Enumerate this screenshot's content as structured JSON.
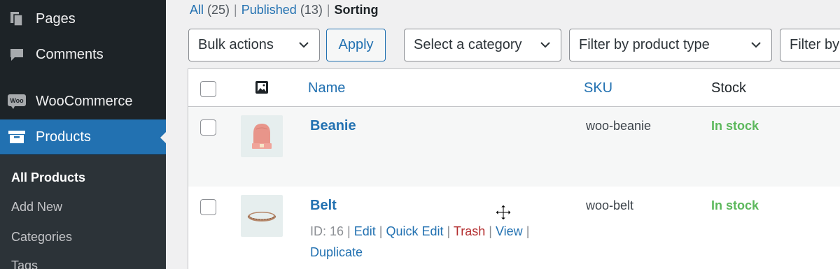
{
  "sidebar": {
    "menu": [
      {
        "label": "Pages",
        "icon": "pages-icon"
      },
      {
        "label": "Comments",
        "icon": "comments-icon"
      },
      {
        "label": "WooCommerce",
        "icon": "woocommerce-icon",
        "icon_text": "Woo"
      },
      {
        "label": "Products",
        "icon": "products-icon"
      }
    ],
    "submenu": [
      "All Products",
      "Add New",
      "Categories",
      "Tags"
    ]
  },
  "filters": {
    "all": "All",
    "all_count": "(25)",
    "published": "Published",
    "published_count": "(13)",
    "sorting": "Sorting",
    "separator": "|"
  },
  "toolbar": {
    "bulk_actions": "Bulk actions",
    "apply": "Apply",
    "category": "Select a category",
    "product_type": "Filter by product type",
    "stock_status": "Filter by"
  },
  "table": {
    "headers": {
      "name": "Name",
      "sku": "SKU",
      "stock": "Stock"
    },
    "rows": [
      {
        "name": "Beanie",
        "sku": "woo-beanie",
        "stock": "In stock"
      },
      {
        "name": "Belt",
        "sku": "woo-belt",
        "stock": "In stock",
        "actions": {
          "id_label": "ID: 16",
          "edit": "Edit",
          "quick_edit": "Quick Edit",
          "trash": "Trash",
          "view": "View",
          "duplicate": "Duplicate",
          "separator": "|"
        }
      }
    ]
  },
  "colors": {
    "sidebar_bg": "#1d2327",
    "accent": "#2271b1",
    "in_stock": "#5cb85c",
    "trash": "#b32d2e"
  }
}
